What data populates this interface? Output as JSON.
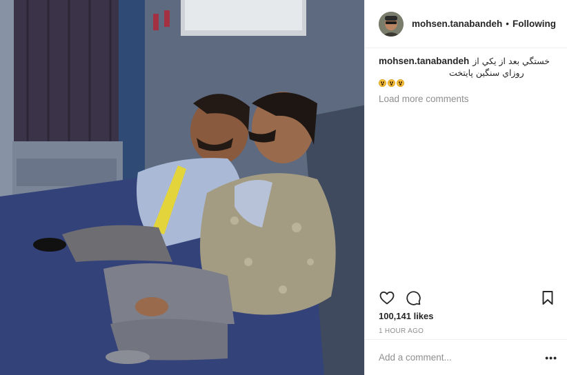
{
  "post": {
    "username": "mohsen.tanabandeh",
    "separator": "•",
    "follow_status": "Following",
    "caption": {
      "username": "mohsen.tanabandeh",
      "line1": "خستگي بعد از يکي از",
      "line2": "روزاي سنگين پايتخت",
      "emoji_count": 3
    },
    "load_more": "Load more comments",
    "likes": "100,141 likes",
    "time": "1 HOUR AGO",
    "comment_placeholder": "Add a comment...",
    "more_options": "•••"
  },
  "icons": {
    "like": "heart-icon",
    "comment": "comment-bubble-icon",
    "save": "bookmark-icon",
    "more": "more-options-icon"
  },
  "colors": {
    "text": "#262626",
    "muted": "#8e8e8e",
    "border": "#efefef"
  }
}
